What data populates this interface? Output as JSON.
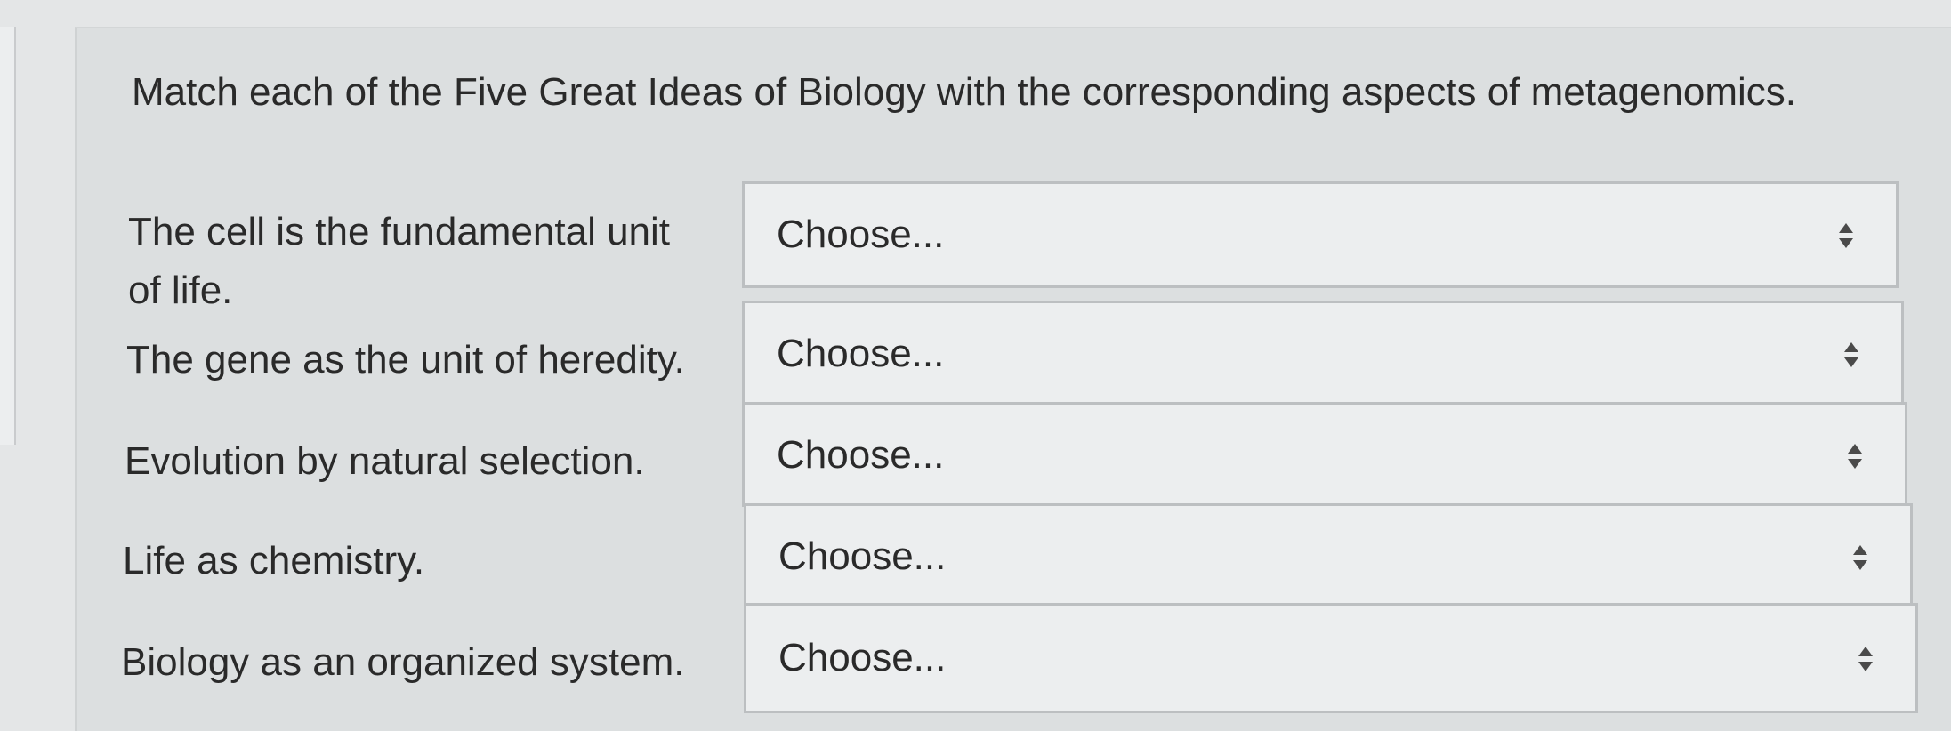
{
  "question": {
    "text": "Match each of the Five Great Ideas of Biology with the corresponding aspects of metagenomics."
  },
  "rows": [
    {
      "label_line1": "The cell is the fundamental unit",
      "label_line2": "of life.",
      "selected": "Choose..."
    },
    {
      "label": "The gene as the unit of heredity.",
      "selected": "Choose..."
    },
    {
      "label": "Evolution by natural selection.",
      "selected": "Choose..."
    },
    {
      "label": "Life as chemistry.",
      "selected": "Choose..."
    },
    {
      "label": "Biology as an organized system.",
      "selected": "Choose..."
    }
  ],
  "icons": {
    "select_arrows": "up-down-arrows-icon"
  }
}
